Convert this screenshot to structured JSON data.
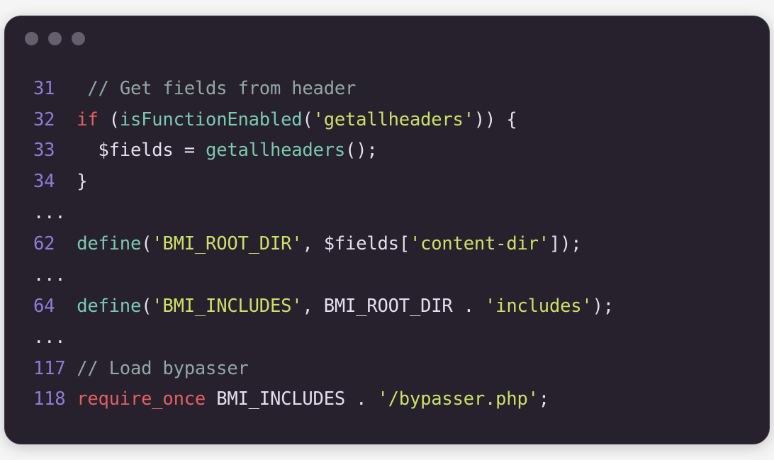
{
  "titlebar": {
    "dot1": "",
    "dot2": "",
    "dot3": ""
  },
  "lines": {
    "l31": {
      "no": "31",
      "sp": "  ",
      "comment": "// Get fields from header"
    },
    "l32": {
      "no": "32",
      "sp": " ",
      "kw_if": "if",
      "p_open": " (",
      "fn": "isFunctionEnabled",
      "p_call_open": "(",
      "str": "'getallheaders'",
      "p_call_close": ")",
      "p_close": ") ",
      "brace": "{"
    },
    "l33": {
      "no": "33",
      "indent": "   ",
      "var": "$fields",
      "op": " = ",
      "fn": "getallheaders",
      "p_call": "()",
      "semi": ";"
    },
    "l34": {
      "no": "34",
      "sp": " ",
      "brace": "}"
    },
    "e1": "...",
    "l62": {
      "no": "62",
      "sp": " ",
      "fn": "define",
      "p_open": "(",
      "str1": "'BMI_ROOT_DIR'",
      "comma": ", ",
      "var": "$fields",
      "bracket_open": "[",
      "str2": "'content-dir'",
      "bracket_close": "]",
      "p_close": ")",
      "semi": ";"
    },
    "e2": "...",
    "l64": {
      "no": "64",
      "sp": " ",
      "fn": "define",
      "p_open": "(",
      "str1": "'BMI_INCLUDES'",
      "comma": ", ",
      "const": "BMI_ROOT_DIR",
      "concat": " . ",
      "str2": "'includes'",
      "p_close": ")",
      "semi": ";"
    },
    "e3": "...",
    "l117": {
      "no": "117",
      "sp": " ",
      "comment": "// Load bypasser"
    },
    "l118": {
      "no": "118",
      "sp": " ",
      "kw": "require_once",
      "space": " ",
      "const": "BMI_INCLUDES",
      "concat": " . ",
      "str": "'/bypasser.php'",
      "semi": ";"
    }
  }
}
